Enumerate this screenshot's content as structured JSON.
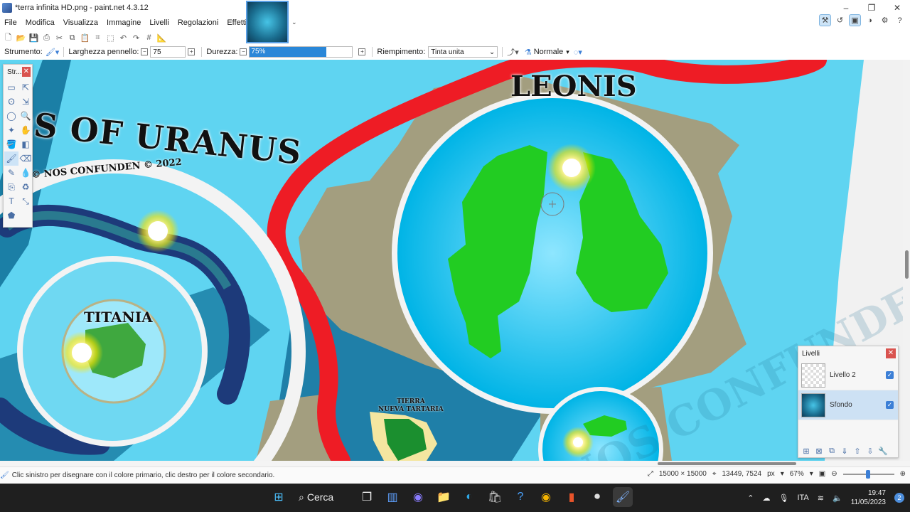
{
  "window": {
    "title": "*terra infinita HD.png - paint.net 4.3.12",
    "controls": [
      "–",
      "❐",
      "✕"
    ]
  },
  "menu": [
    "File",
    "Modifica",
    "Visualizza",
    "Immagine",
    "Livelli",
    "Regolazioni",
    "Effetti"
  ],
  "options": {
    "tool_label": "Strumento:",
    "brush_width_label": "Larghezza pennello:",
    "brush_width_value": "75",
    "hardness_label": "Durezza:",
    "hardness_value": "75%",
    "hardness_fraction": 0.75,
    "fill_label": "Riempimento:",
    "fill_value": "Tinta unita",
    "blend_value": "Normale"
  },
  "map": {
    "title_left": "DS OF URANUS",
    "copyright": "© NOS CONFUNDEN © 2022",
    "leonis": "LEONIS",
    "titania": "TITANIA",
    "tierra_line1": "TIERRA",
    "tierra_line2": "NUEVA TARTARIA",
    "watermark": "NOS CONFUNDEN"
  },
  "tools_panel": {
    "title": "Str..."
  },
  "layers_panel": {
    "title": "Livelli",
    "layers": [
      {
        "name": "Livello 2",
        "selected": false,
        "visible": true
      },
      {
        "name": "Sfondo",
        "selected": true,
        "visible": true
      }
    ]
  },
  "status": {
    "hint": "Clic sinistro per disegnare con il colore primario, clic destro per il colore secondario.",
    "image_size": "15000 × 15000",
    "cursor_pos": "13449, 7524",
    "units": "px",
    "zoom": "67%"
  },
  "taskbar": {
    "search": "Cerca",
    "lang": "ITA",
    "time": "19:47",
    "date": "11/05/2023",
    "notifications": "2"
  },
  "colors": {
    "accent": "#2a87d8",
    "sea": "#5fd4f1",
    "land": "#22cc22",
    "road": "#ee1c25"
  }
}
